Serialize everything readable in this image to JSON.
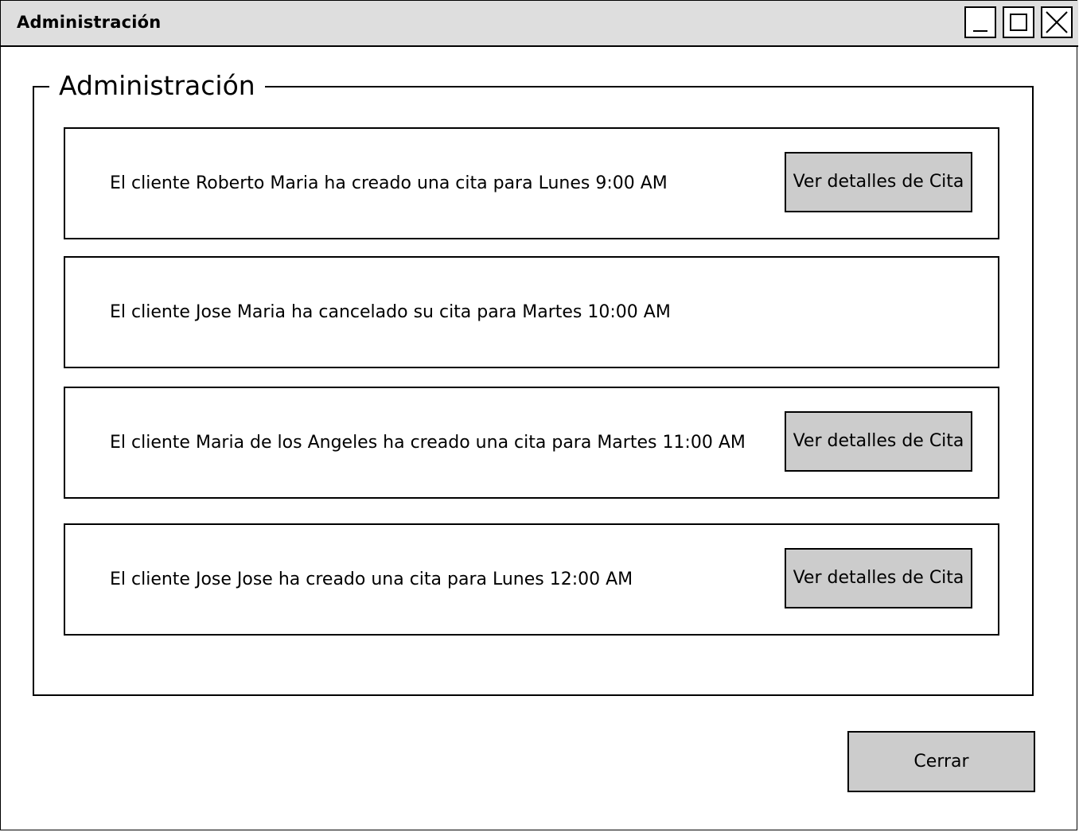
{
  "window": {
    "title": "Administración",
    "controls": {
      "minimize_icon": "minimize-icon",
      "maximize_icon": "maximize-icon",
      "close_icon": "close-icon"
    }
  },
  "panel": {
    "title": "Administración"
  },
  "notifications": [
    {
      "text": "El cliente Roberto Maria ha creado una cita para Lunes 9:00 AM",
      "button_label": "Ver detalles de Cita"
    },
    {
      "text": "El cliente Jose Maria ha cancelado su cita para Martes 10:00 AM",
      "button_label": ""
    },
    {
      "text": "El cliente Maria de los Angeles ha creado una cita para Martes 11:00 AM",
      "button_label": "Ver detalles de Cita"
    },
    {
      "text": "El cliente Jose Jose ha creado una cita para Lunes 12:00 AM",
      "button_label": "Ver detalles de Cita"
    }
  ],
  "footer": {
    "close_label": "Cerrar"
  },
  "colors": {
    "titlebar_bg": "#dedede",
    "button_bg": "#cccccc",
    "border": "#000000"
  }
}
